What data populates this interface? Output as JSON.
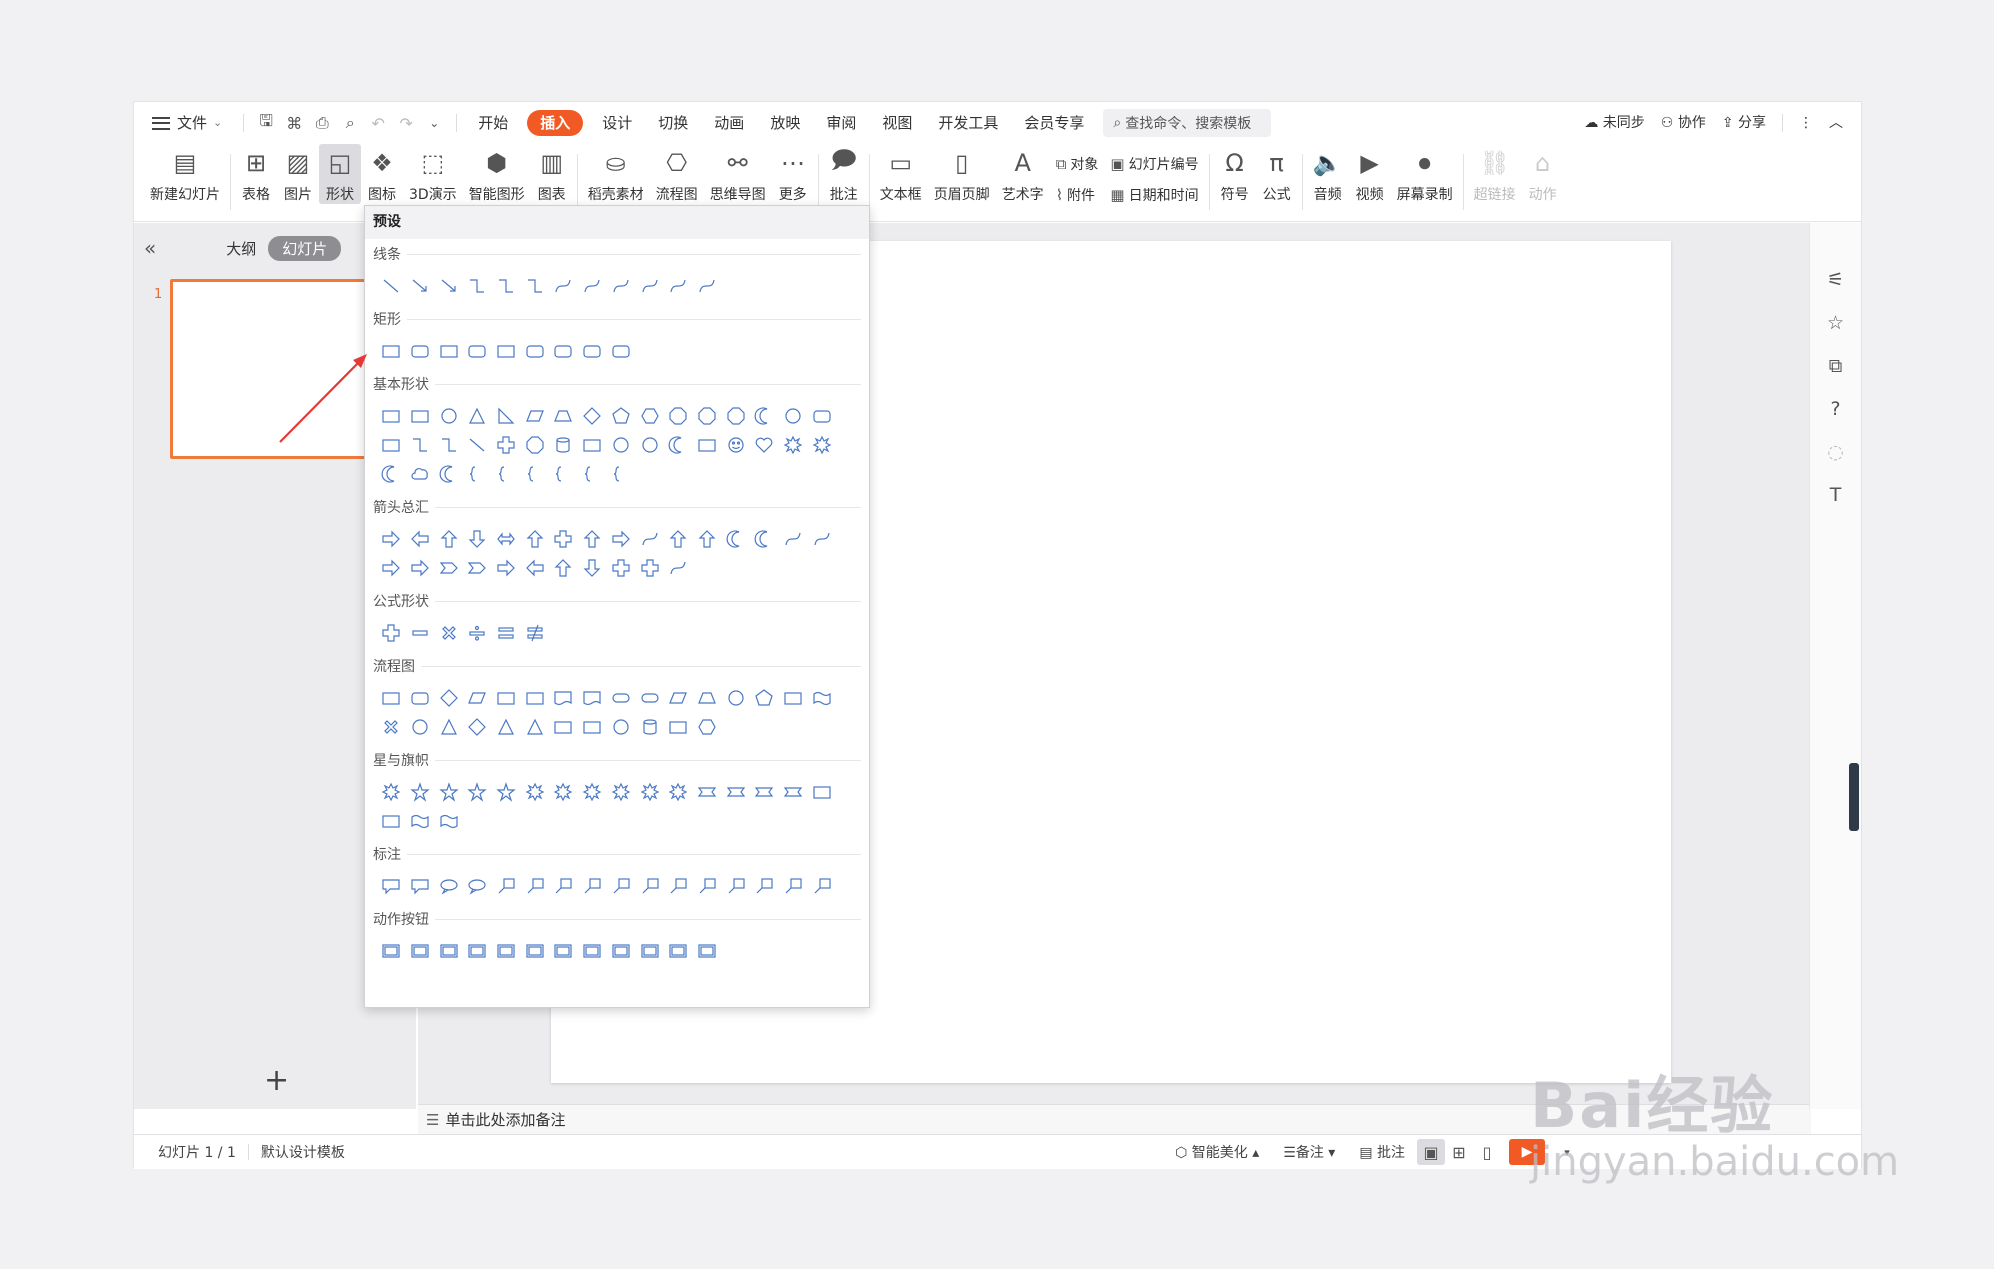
{
  "menubar": {
    "file": "文件",
    "tabs": [
      "开始",
      "插入",
      "设计",
      "切换",
      "动画",
      "放映",
      "审阅",
      "视图",
      "开发工具",
      "会员专享"
    ],
    "active_tab": "插入",
    "search_placeholder": "查找命令、搜索模板",
    "sync": "未同步",
    "collab": "协作",
    "share": "分享"
  },
  "ribbon": {
    "new_slide": "新建幻灯片",
    "table": "表格",
    "picture": "图片",
    "shape": "形状",
    "icon": "图标",
    "threed": "3D演示",
    "smart_art": "智能图形",
    "chart": "图表",
    "docer": "稻壳素材",
    "flowchart": "流程图",
    "mindmap": "思维导图",
    "more": "更多",
    "comment": "批注",
    "textbox": "文本框",
    "header_footer": "页眉页脚",
    "wordart": "艺术字",
    "object": "对象",
    "attachment": "附件",
    "slide_number": "幻灯片编号",
    "datetime": "日期和时间",
    "symbol": "符号",
    "formula": "公式",
    "audio": "音频",
    "video": "视频",
    "screen_record": "屏幕录制",
    "hyperlink": "超链接",
    "action": "动作"
  },
  "leftpanel": {
    "outline": "大纲",
    "slides": "幻灯片",
    "slide_number": "1"
  },
  "dropdown": {
    "title": "预设",
    "sections": {
      "lines": "线条",
      "rect": "矩形",
      "basic": "基本形状",
      "arrows": "箭头总汇",
      "formula": "公式形状",
      "flow": "流程图",
      "stars": "星与旗帜",
      "callouts": "标注",
      "actions": "动作按钮"
    }
  },
  "notes": {
    "placeholder": "单击此处添加备注"
  },
  "status": {
    "slide_info": "幻灯片 1 / 1",
    "template": "默认设计模板",
    "beautify": "智能美化",
    "notes": "备注",
    "comments": "批注"
  },
  "watermark": {
    "brand": "Bai经验",
    "url": "jingyan.baidu.com"
  },
  "colors": {
    "accent": "#f15a24",
    "shape_stroke": "#4a78c4",
    "annotation_arrow": "#e53935"
  }
}
